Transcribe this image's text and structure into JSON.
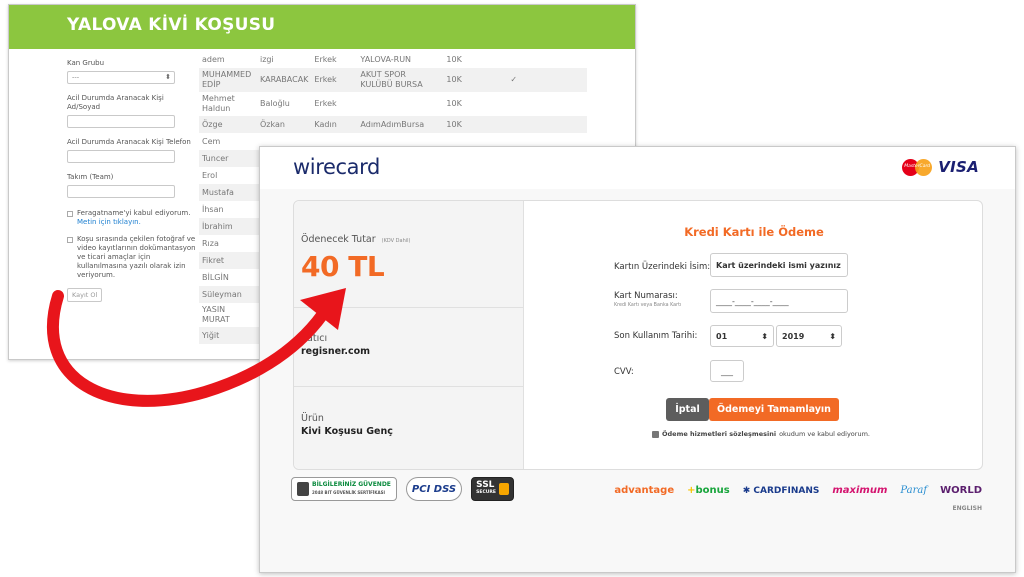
{
  "back_page": {
    "title": "YALOVA KİVİ KOŞUSU",
    "form": {
      "blood_label": "Kan Grubu",
      "blood_value": "---",
      "contact_name_label": "Acil Durumda Aranacak Kişi Ad/Soyad",
      "contact_phone_label": "Acil Durumda Aranacak Kişi Telefon",
      "team_label": "Takım (Team)",
      "waiver_text": "Feragatname'yi kabul ediyorum.",
      "waiver_link": "Metin için tıklayın.",
      "photo_consent": "Koşu sırasında çekilen fotoğraf ve video kayıtlarının dokümantasyon ve ticari amaçlar için kullanılmasına yazılı olarak izin veriyorum.",
      "submit_label": "Kayıt Ol"
    },
    "rows": [
      {
        "first": "adem",
        "last": "izgi",
        "gender": "Erkek",
        "club": "YALOVA-RUN",
        "dist": "10K",
        "mark": ""
      },
      {
        "first": "MUHAMMED EDİP",
        "last": "KARABACAK",
        "gender": "Erkek",
        "club": "AKUT SPOR KULÜBÜ BURSA",
        "dist": "10K",
        "mark": "✓"
      },
      {
        "first": "Mehmet Haldun",
        "last": "Baloğlu",
        "gender": "Erkek",
        "club": "",
        "dist": "10K",
        "mark": ""
      },
      {
        "first": "Özge",
        "last": "Özkan",
        "gender": "Kadın",
        "club": "AdımAdımBursa",
        "dist": "10K",
        "mark": ""
      },
      {
        "first": "Cem",
        "last": "",
        "gender": "",
        "club": "",
        "dist": "",
        "mark": ""
      },
      {
        "first": "Tuncer",
        "last": "",
        "gender": "",
        "club": "",
        "dist": "",
        "mark": ""
      },
      {
        "first": "Erol",
        "last": "",
        "gender": "",
        "club": "",
        "dist": "",
        "mark": ""
      },
      {
        "first": "Mustafa",
        "last": "",
        "gender": "",
        "club": "",
        "dist": "",
        "mark": ""
      },
      {
        "first": "İhsan",
        "last": "",
        "gender": "",
        "club": "",
        "dist": "",
        "mark": ""
      },
      {
        "first": "İbrahim",
        "last": "",
        "gender": "",
        "club": "",
        "dist": "",
        "mark": ""
      },
      {
        "first": "Rıza",
        "last": "",
        "gender": "",
        "club": "",
        "dist": "",
        "mark": ""
      },
      {
        "first": "Fikret",
        "last": "",
        "gender": "",
        "club": "",
        "dist": "",
        "mark": ""
      },
      {
        "first": "BİLGİN",
        "last": "",
        "gender": "",
        "club": "",
        "dist": "",
        "mark": ""
      },
      {
        "first": "Süleyman",
        "last": "",
        "gender": "",
        "club": "",
        "dist": "",
        "mark": ""
      },
      {
        "first": "YASIN MURAT",
        "last": "",
        "gender": "",
        "club": "",
        "dist": "",
        "mark": ""
      },
      {
        "first": "Yiğit",
        "last": "",
        "gender": "",
        "club": "",
        "dist": "",
        "mark": ""
      }
    ]
  },
  "payment": {
    "brand": "wirecard",
    "mastercard_text": "MasterCard",
    "visa_text": "VISA",
    "amount_label": "Ödenecek Tutar",
    "kdv_note": "(KDV Dahil)",
    "amount": "40 TL",
    "seller_label": "Satıcı",
    "seller": "regisner.com",
    "product_label": "Ürün",
    "product": "Kivi Koşusu Genç",
    "form_title": "Kredi Kartı ile Ödeme",
    "name_label": "Kartın Üzerindeki İsim:",
    "name_placeholder": "Kart üzerindeki ismi yazınız",
    "number_label": "Kart Numarası:",
    "number_hint": "Kredi Kartı veya Banka Kartı",
    "number_placeholder": "____-____-____-____",
    "expiry_label": "Son Kullanım Tarihi:",
    "expiry_month": "01",
    "expiry_year": "2019",
    "cvv_label": "CVV:",
    "cvv_placeholder": "___",
    "cancel_label": "İptal",
    "pay_label": "Ödemeyi Tamamlayın",
    "agreement_link": "Ödeme hizmetleri sözleşmesini",
    "agreement_rest": "okudum ve kabul ediyorum.",
    "badge_secure_1": "BİLGİLERİNİZ GÜVENDE",
    "badge_secure_2": "2048 BIT GÜVENLİK SERTİFİKASI",
    "badge_pci": "PCI DSS",
    "badge_ssl_1": "SSL",
    "badge_ssl_2": "SECURE",
    "banks": [
      "advantage",
      "bonus",
      "CARDFINANS",
      "maximum",
      "Paraf",
      "WORLD"
    ],
    "language": "ENGLISH"
  },
  "colors": {
    "header_green": "#8cc63f",
    "accent_orange": "#f26a25",
    "arrow_red": "#e8151b"
  }
}
